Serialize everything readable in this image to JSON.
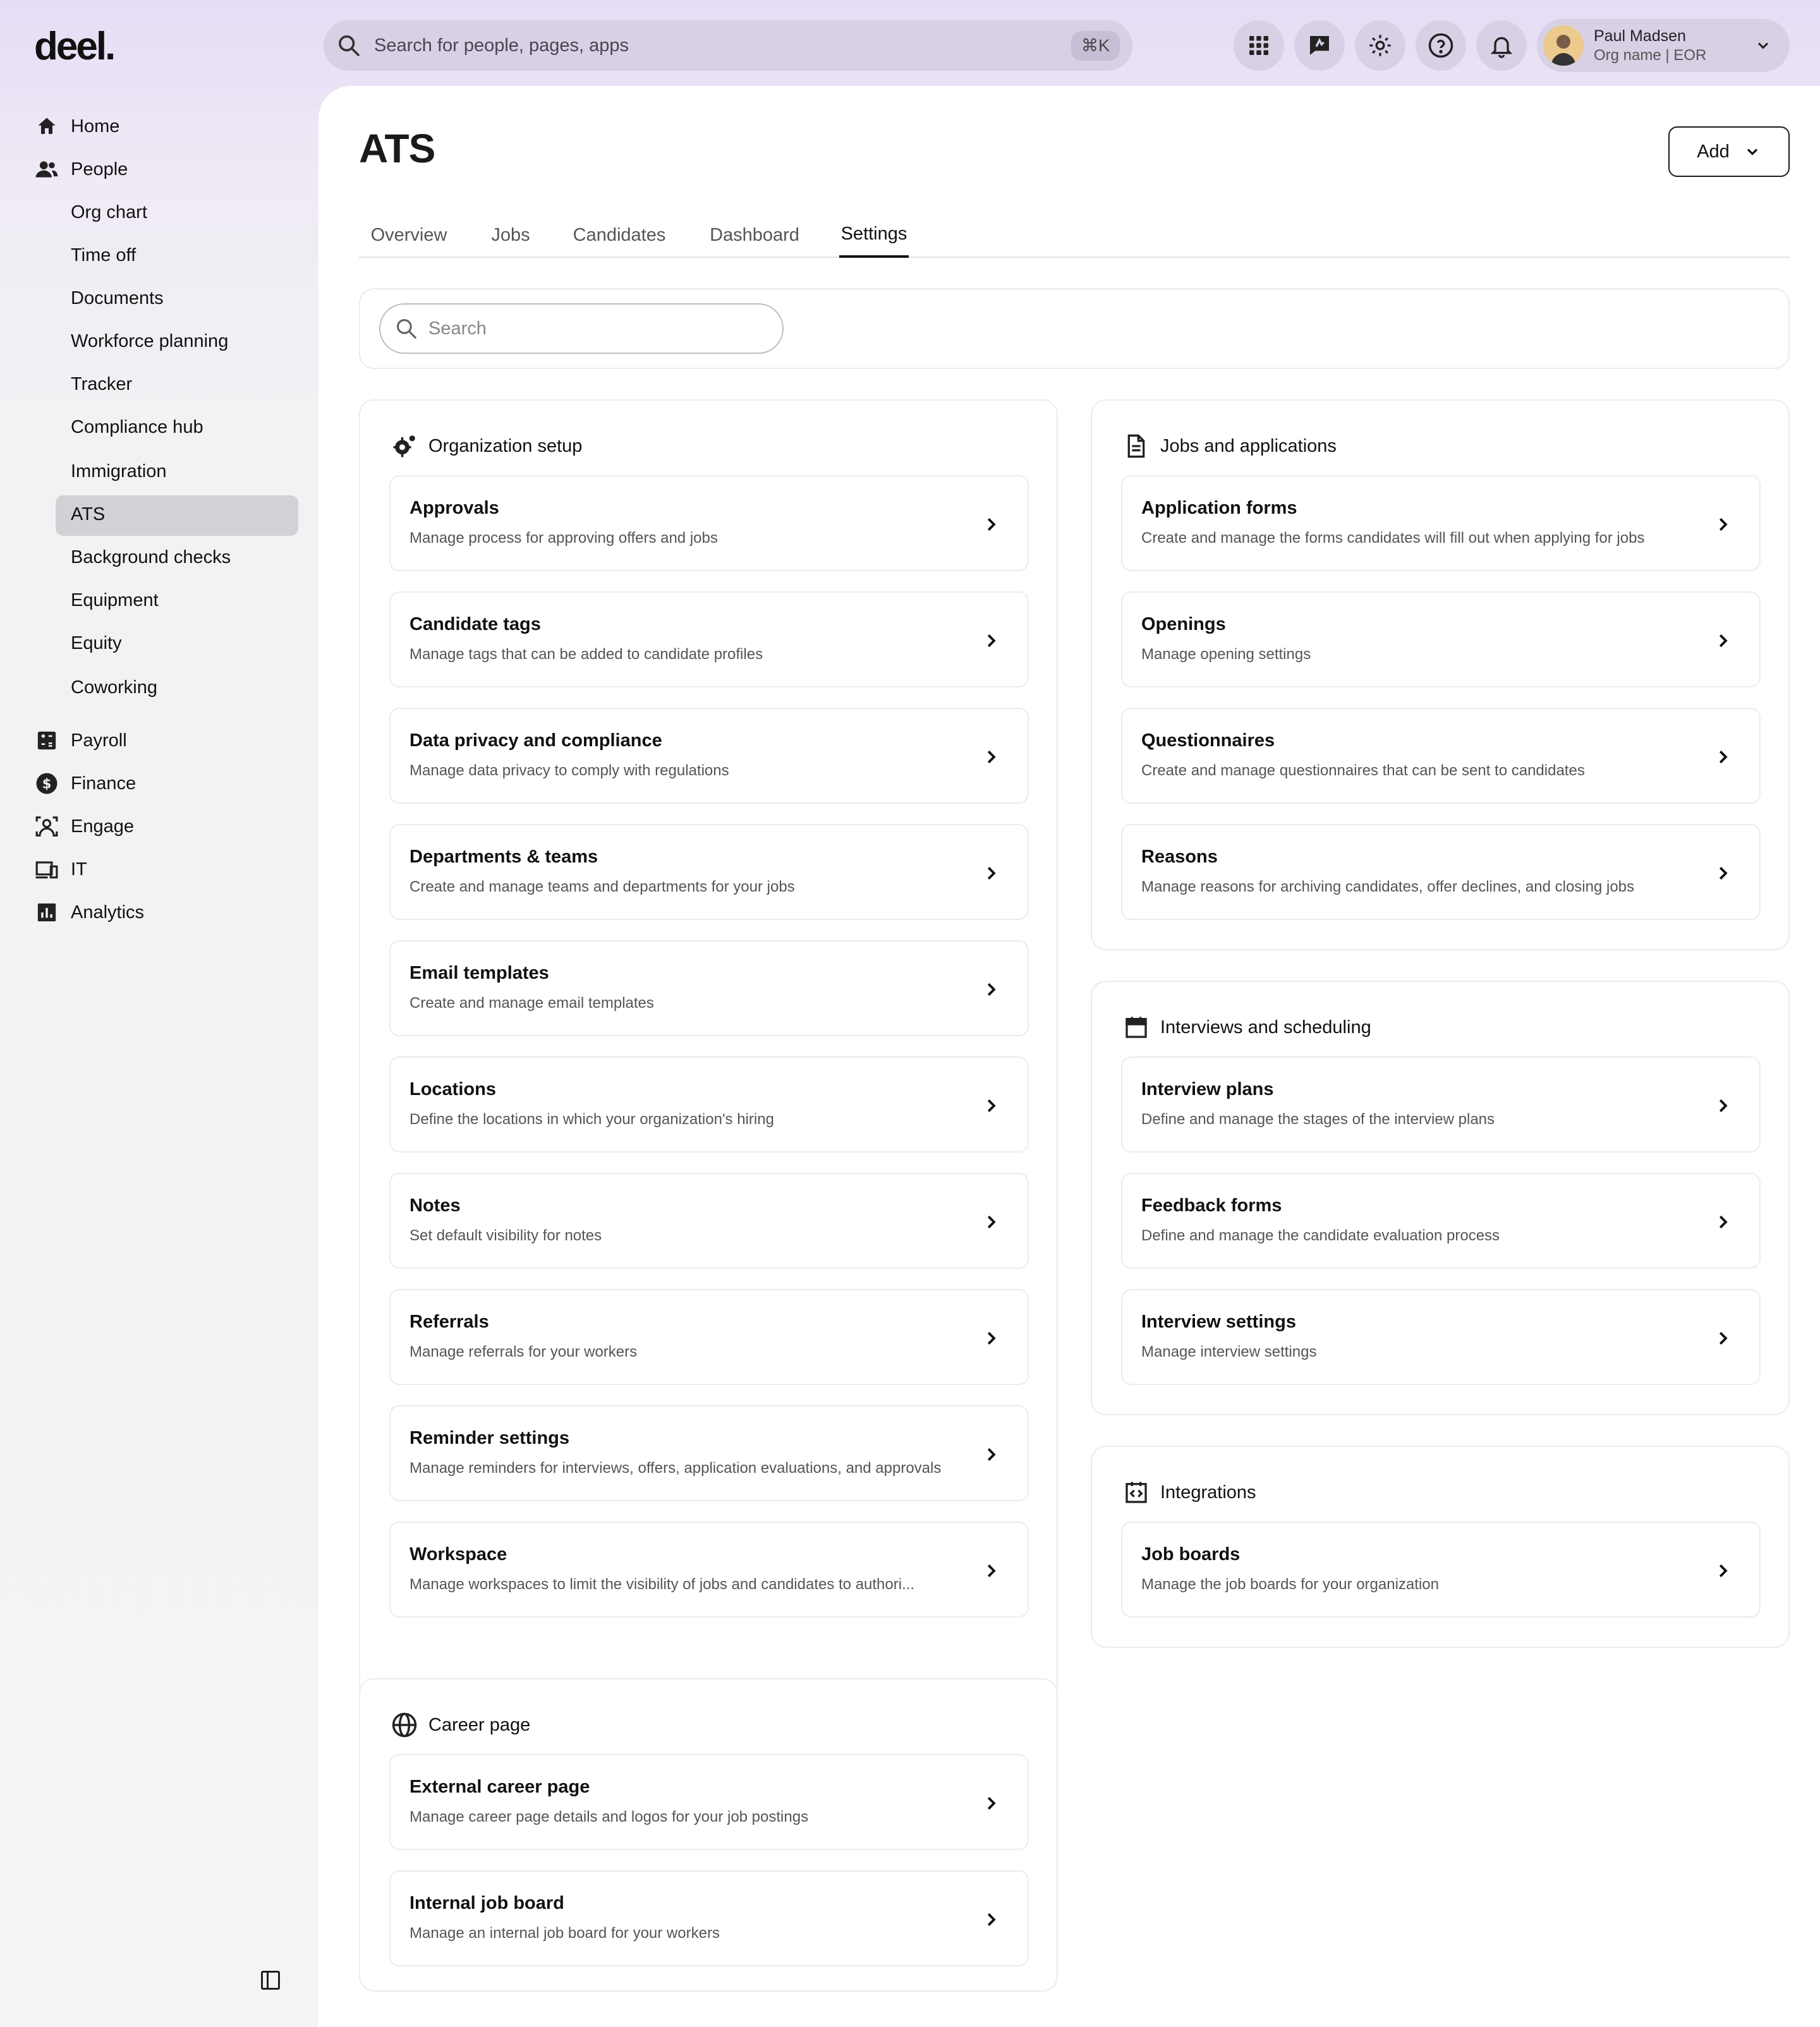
{
  "app": {
    "logo": "deel."
  },
  "topbar": {
    "search_placeholder": "Search for people, pages, apps",
    "shortcut": "⌘K",
    "user": {
      "name": "Paul Madsen",
      "org": "Org name | EOR"
    }
  },
  "sidebar": {
    "main": [
      {
        "label": "Home",
        "icon": "home-icon"
      },
      {
        "label": "People",
        "icon": "people-icon"
      }
    ],
    "people_sub": [
      "Org chart",
      "Time off",
      "Documents",
      "Workforce planning",
      "Tracker",
      "Compliance hub",
      "Immigration",
      "ATS",
      "Background checks",
      "Equipment",
      "Equity",
      "Coworking"
    ],
    "active_sub": "ATS",
    "bottom": [
      {
        "label": "Payroll",
        "icon": "payroll-icon"
      },
      {
        "label": "Finance",
        "icon": "finance-icon"
      },
      {
        "label": "Engage",
        "icon": "engage-icon"
      },
      {
        "label": "IT",
        "icon": "it-devices-icon"
      },
      {
        "label": "Analytics",
        "icon": "analytics-icon"
      }
    ]
  },
  "page": {
    "title": "ATS",
    "add_label": "Add",
    "tabs": [
      "Overview",
      "Jobs",
      "Candidates",
      "Dashboard",
      "Settings"
    ],
    "active_tab": "Settings",
    "search_placeholder": "Search"
  },
  "sections": {
    "org": {
      "title": "Organization setup",
      "items": [
        {
          "title": "Approvals",
          "desc": "Manage process for approving offers and jobs"
        },
        {
          "title": "Candidate tags",
          "desc": "Manage tags that can be added to candidate profiles"
        },
        {
          "title": "Data privacy and compliance",
          "desc": "Manage data privacy to comply with regulations"
        },
        {
          "title": "Departments & teams",
          "desc": "Create and manage teams and departments for your jobs"
        },
        {
          "title": "Email templates",
          "desc": "Create and manage email templates"
        },
        {
          "title": "Locations",
          "desc": "Define the locations in which your organization's hiring"
        },
        {
          "title": "Notes",
          "desc": "Set default visibility for notes"
        },
        {
          "title": "Referrals",
          "desc": "Manage referrals for your workers"
        },
        {
          "title": "Reminder settings",
          "desc": "Manage reminders for interviews, offers, application evaluations, and approvals"
        },
        {
          "title": "Workspace",
          "desc": "Manage workspaces to limit the visibility of jobs and candidates to authori..."
        }
      ]
    },
    "jobs": {
      "title": "Jobs and applications",
      "items": [
        {
          "title": "Application forms",
          "desc": "Create and manage the forms candidates will fill out when applying for jobs"
        },
        {
          "title": "Openings",
          "desc": "Manage opening settings"
        },
        {
          "title": "Questionnaires",
          "desc": "Create and manage questionnaires that can be sent to candidates"
        },
        {
          "title": "Reasons",
          "desc": "Manage reasons for archiving candidates, offer declines, and closing jobs"
        }
      ]
    },
    "interviews": {
      "title": "Interviews and scheduling",
      "items": [
        {
          "title": "Interview plans",
          "desc": "Define and manage the stages of the interview plans"
        },
        {
          "title": "Feedback forms",
          "desc": "Define and manage the candidate evaluation process"
        },
        {
          "title": "Interview settings",
          "desc": "Manage interview settings"
        }
      ]
    },
    "integrations": {
      "title": "Integrations",
      "items": [
        {
          "title": "Job boards",
          "desc": "Manage the job boards for your organization"
        }
      ]
    },
    "career": {
      "title": "Career page",
      "items": [
        {
          "title": "External career page",
          "desc": "Manage career page details and logos for your job postings"
        },
        {
          "title": "Internal job board",
          "desc": "Manage an internal job board for your workers"
        }
      ]
    }
  }
}
